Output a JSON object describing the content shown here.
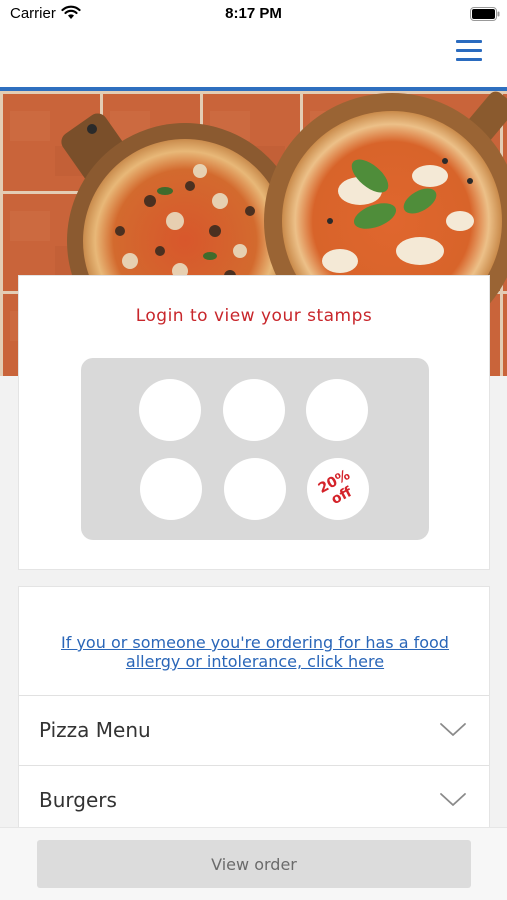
{
  "status_bar": {
    "carrier": "Carrier",
    "time": "8:17 PM"
  },
  "nav": {
    "menu_icon": "hamburger-menu-icon",
    "accent_color": "#2f6fbf"
  },
  "hero": {
    "image": "two pizzas on wooden boards on a terracotta tile table"
  },
  "stamps": {
    "title": "Login to view your stamps",
    "reward_line1": "20%",
    "reward_line2": "off",
    "reward_color": "#d4232a"
  },
  "menu": {
    "allergy_link": "If you or someone you're ordering for has a food allergy or intolerance, click here",
    "categories": [
      {
        "label": "Pizza Menu"
      },
      {
        "label": "Burgers"
      }
    ]
  },
  "footer": {
    "view_order_label": "View order"
  }
}
